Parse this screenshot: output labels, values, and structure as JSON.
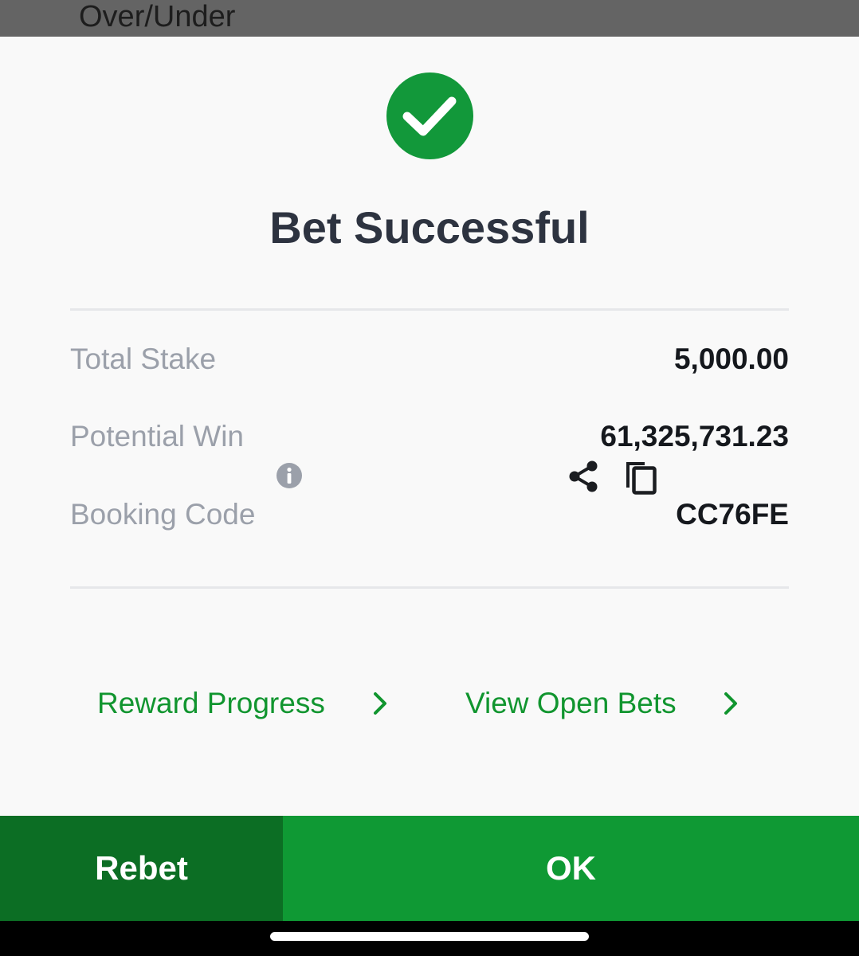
{
  "header": {
    "market_title": "Over/Under"
  },
  "dialog": {
    "icon": "check-circle-icon",
    "title": "Bet Successful",
    "rows": {
      "total_stake": {
        "label": "Total Stake",
        "value": "5,000.00"
      },
      "potential_win": {
        "label": "Potential Win",
        "value": "61,325,731.23"
      },
      "booking_code": {
        "label": "Booking Code",
        "value": "CC76FE"
      }
    },
    "links": {
      "reward_progress": "Reward Progress",
      "view_open_bets": "View Open Bets"
    }
  },
  "footer": {
    "rebet_label": "Rebet",
    "ok_label": "OK"
  },
  "colors": {
    "brand_green": "#0f9934",
    "dark_green": "#0c6e24",
    "link_green": "#11952f",
    "title_text": "#2d3340",
    "muted_label": "#9ba0aa"
  }
}
